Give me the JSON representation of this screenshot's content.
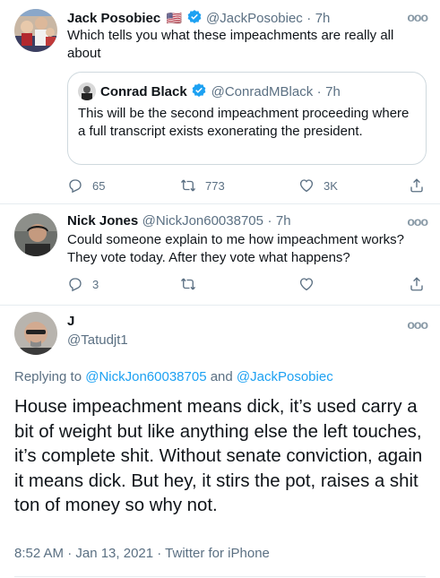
{
  "tweets": [
    {
      "name": "Jack Posobiec",
      "flag": "🇺🇸",
      "handle": "@JackPosobiec",
      "separator": "·",
      "time": "7h",
      "text": "Which tells you what these impeachments are really all about",
      "quote": {
        "name": "Conrad Black",
        "handle": "@ConradMBlack",
        "separator": "·",
        "time": "7h",
        "text": "This will be the second impeachment proceeding where a full transcript exists exonerating the president."
      },
      "replies": "65",
      "retweets": "773",
      "likes": "3K"
    },
    {
      "name": "Nick Jones",
      "handle": "@NickJon60038705",
      "separator": "·",
      "time": "7h",
      "text": "Could someone explain to me how impeachment works? They vote today.  After they vote what happens?",
      "replies": "3"
    }
  ],
  "main_tweet": {
    "name": "J",
    "handle": "@Tatudjt1",
    "replying_prefix": "Replying to",
    "replying_to_1": "@NickJon60038705",
    "replying_and": "and",
    "replying_to_2": "@JackPosobiec",
    "text": "House impeachment means dick, it’s used carry a bit of weight but like anything else the left touches, it’s complete shit. Without senate conviction, again it means dick.  But hey, it stirs the pot, raises a shit ton of money so why not.",
    "timestamp": "8:52 AM · Jan 13, 2021 · ",
    "source": "Twitter for iPhone"
  },
  "colors": {
    "link": "#1da1f2",
    "verified": "#1da1f2",
    "muted": "#5b7083",
    "border": "#cfd9de"
  },
  "icons": [
    "reply-icon",
    "retweet-icon",
    "like-icon",
    "share-icon",
    "verified-icon",
    "more-icon"
  ]
}
